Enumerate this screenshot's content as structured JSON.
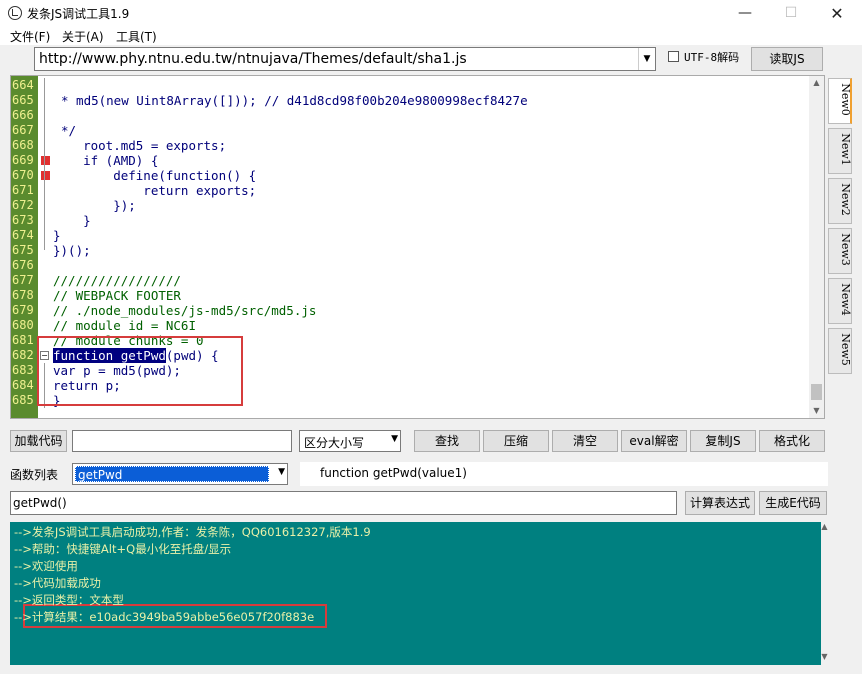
{
  "window": {
    "title": "发条JS调试工具1.9",
    "min_glyph": "—",
    "max_glyph": "☐",
    "close_glyph": "✕"
  },
  "menu": {
    "file": "文件(F)",
    "about": "关于(A)",
    "tools": "工具(T)"
  },
  "toolbar": {
    "url": "http://www.phy.ntnu.edu.tw/ntnujava/Themes/default/sha1.js",
    "utf8_label": "UTF-8解码",
    "read_button": "读取JS"
  },
  "editor": {
    "line_numbers": [
      "664",
      "665",
      "666",
      "667",
      "668",
      "669",
      "670",
      "671",
      "672",
      "673",
      "674",
      "675",
      "676",
      "677",
      "678",
      "679",
      "680",
      "681",
      "682",
      "683",
      "684",
      "685"
    ],
    "lines": [
      "",
      "* md5(new Uint8Array([])); // d41d8cd98f00b204e9800998ecf8427e",
      "",
      "*/",
      "    root.md5 = exports;",
      "    if (AMD) {",
      "        define(function() {",
      "            return exports;",
      "        });",
      "    }",
      "}",
      "})();",
      "",
      "/////////////////",
      "// WEBPACK FOOTER",
      "// ./node_modules/js-md5/src/md5.js",
      "// module id = NC6I",
      "// module chunks = 0",
      "(pwd) {",
      "var p = md5(pwd);",
      "return p;",
      "}"
    ],
    "selected_text": "function getPwd"
  },
  "tabs": [
    "New0",
    "New1",
    "New2",
    "New3",
    "New4",
    "New5"
  ],
  "controls": {
    "load_code": "加载代码",
    "case_option": "区分大小写",
    "find": "查找",
    "compress": "压缩",
    "clear": "清空",
    "eval_decrypt": "eval解密",
    "copy_js": "复制JS",
    "format": "格式化"
  },
  "functions": {
    "label": "函数列表",
    "selected": "getPwd",
    "signature": "function getPwd(value1)"
  },
  "expression": {
    "value": "getPwd()",
    "calc_button": "计算表达式",
    "gen_button": "生成E代码"
  },
  "console": {
    "lines": [
      "-->发条JS调试工具启动成功,作者：发条陈，QQ601612327,版本1.9",
      "-->帮助：快捷键Alt+Q最小化至托盘/显示",
      "-->欢迎使用",
      "-->代码加载成功",
      "-->返回类型：文本型",
      "-->计算结果：e10adc3949ba59abbe56e057f20f883e"
    ]
  },
  "colors": {
    "gutter": "#5a8b2e",
    "console_bg": "#008080",
    "highlight_box": "#d63c3c",
    "selection": "#0b5ed7"
  }
}
